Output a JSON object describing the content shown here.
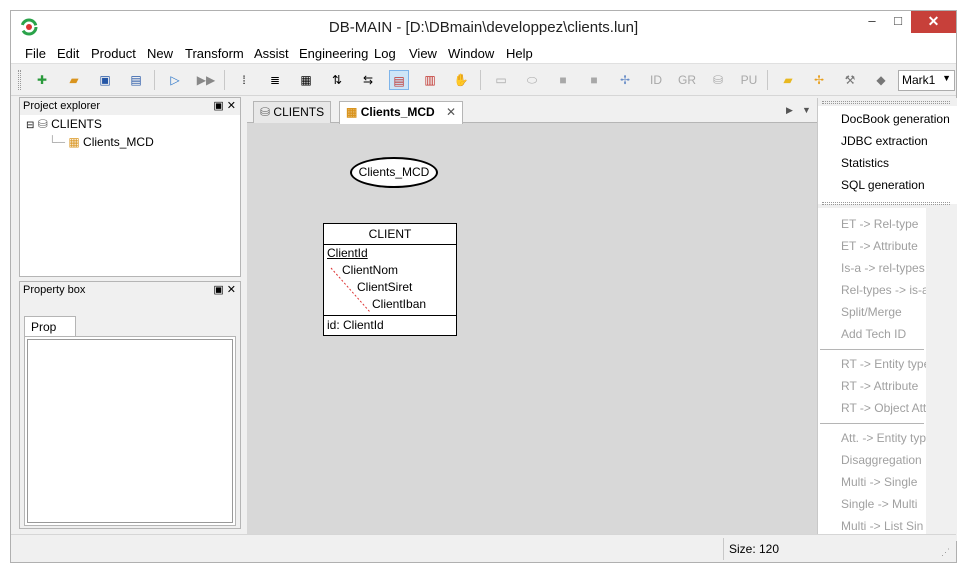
{
  "window": {
    "title": "DB-MAIN  - [D:\\DBmain\\developpez\\clients.lun]",
    "min_symbol": "–",
    "max_symbol": "□",
    "close_symbol": "✕"
  },
  "menu": [
    "File",
    "Edit",
    "Product",
    "New",
    "Transform",
    "Assist",
    "Engineering",
    "Log",
    "View",
    "Window",
    "Help"
  ],
  "toolbar": {
    "id_label": "ID",
    "gr_label": "GR",
    "pu_label": "PU",
    "mark_select": {
      "value": "Mark1"
    }
  },
  "project_explorer": {
    "title": "Project explorer",
    "items": [
      {
        "label": "CLIENTS"
      },
      {
        "label": "Clients_MCD"
      }
    ]
  },
  "property_box": {
    "title": "Property box",
    "tab": "Prop"
  },
  "tabs": [
    {
      "label": "CLIENTS"
    },
    {
      "label": "Clients_MCD"
    }
  ],
  "tab_close_symbol": "✕",
  "diagram": {
    "schema_name": "Clients_MCD",
    "entity": {
      "name": "CLIENT",
      "attributes": [
        "ClientId",
        "ClientNom",
        "ClientSiret",
        "ClientIban"
      ],
      "identifier": "id: ClientId"
    }
  },
  "assist_panel": {
    "generators": [
      "DocBook generation",
      "JDBC extraction",
      "Statistics",
      "SQL generation"
    ],
    "transforms": [
      [
        "ET -> Rel-type",
        "ET -> Attribute",
        "Is-a -> rel-types",
        "Rel-types -> is-a",
        "Split/Merge",
        "Add Tech ID"
      ],
      [
        "RT -> Entity type",
        "RT -> Attribute",
        "RT -> Object Att"
      ],
      [
        "Att. -> Entity type",
        "Disaggregation",
        "Multi -> Single",
        "Single -> Multi",
        "Multi -> List Sin"
      ]
    ]
  },
  "status": {
    "size": "Size: 120"
  }
}
